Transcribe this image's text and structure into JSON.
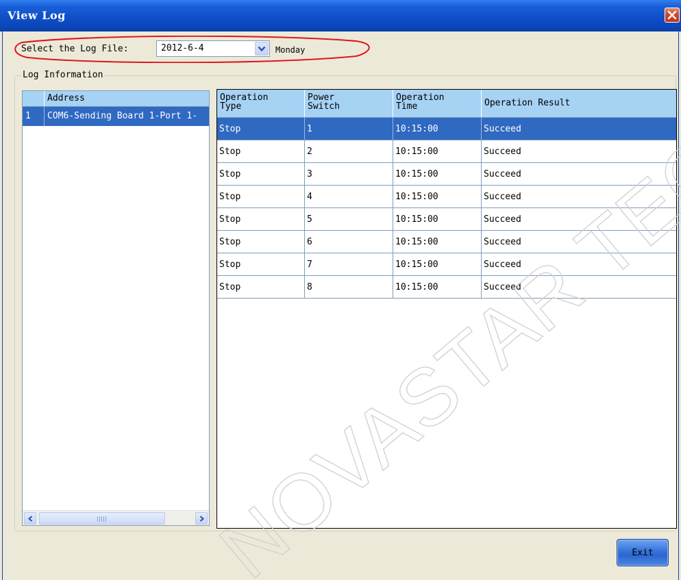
{
  "window": {
    "title": "View Log",
    "close_icon": "close-icon",
    "titlebar_color": "#0f4fc8",
    "close_button_color": "#d2462b"
  },
  "log_file": {
    "label": "Select the Log File:",
    "selected_value": "2012-6-4",
    "day": "Monday",
    "dropdown_icon": "chevron-down-icon",
    "highlight_color": "#e0141c"
  },
  "log_information": {
    "group_title": "Log Information",
    "address_list": {
      "header": "Address",
      "rows": [
        {
          "num": "1",
          "address": "COM6-Sending Board 1-Port 1-"
        }
      ]
    },
    "scrollbar": {
      "left_icon": "chevron-left-icon",
      "right_icon": "chevron-right-icon"
    },
    "operations": {
      "columns": [
        "Operation\nType",
        "Power\nSwitch",
        "Operation\nTime",
        "Operation Result"
      ],
      "rows": [
        [
          "Stop",
          "1",
          "10:15:00",
          "Succeed"
        ],
        [
          "Stop",
          "2",
          "10:15:00",
          "Succeed"
        ],
        [
          "Stop",
          "3",
          "10:15:00",
          "Succeed"
        ],
        [
          "Stop",
          "4",
          "10:15:00",
          "Succeed"
        ],
        [
          "Stop",
          "5",
          "10:15:00",
          "Succeed"
        ],
        [
          "Stop",
          "6",
          "10:15:00",
          "Succeed"
        ],
        [
          "Stop",
          "7",
          "10:15:00",
          "Succeed"
        ],
        [
          "Stop",
          "8",
          "10:15:00",
          "Succeed"
        ]
      ],
      "selected_row_index": 0,
      "selection_color": "#2f69c1",
      "header_color": "#a6d2f4"
    }
  },
  "footer": {
    "exit_label": "Exit"
  },
  "watermark": {
    "text": "NOVASTAR TECH CO., L"
  }
}
